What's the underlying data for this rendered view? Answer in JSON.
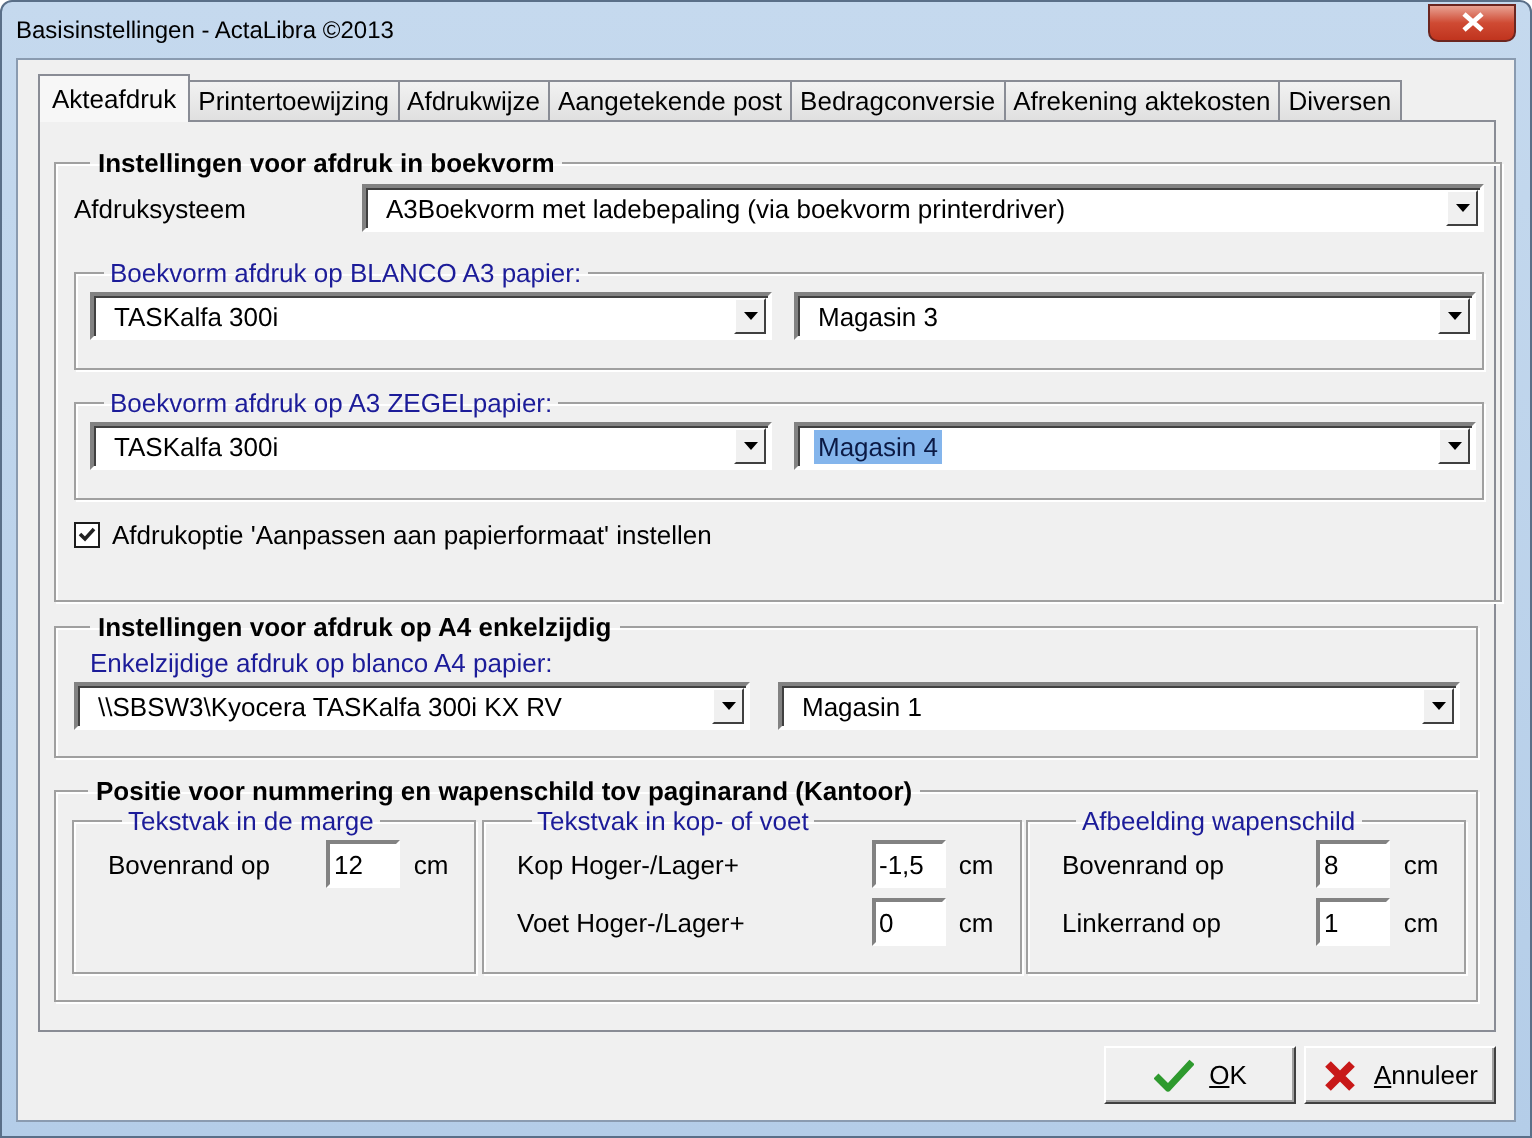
{
  "window": {
    "title": "Basisinstellingen - ActaLibra ©2013"
  },
  "tabs": [
    {
      "label": "Akteafdruk",
      "selected": true
    },
    {
      "label": "Printertoewijzing",
      "selected": false
    },
    {
      "label": "Afdrukwijze",
      "selected": false
    },
    {
      "label": "Aangetekende post",
      "selected": false
    },
    {
      "label": "Bedragconversie",
      "selected": false
    },
    {
      "label": "Afrekening aktekosten",
      "selected": false
    },
    {
      "label": "Diversen",
      "selected": false
    }
  ],
  "book_group": {
    "title": "Instellingen voor afdruk in boekvorm",
    "system": {
      "label": "Afdruksysteem",
      "value": "A3Boekvorm met ladebepaling (via boekvorm printerdriver)"
    },
    "subgroups": [
      {
        "title": "Boekvorm afdruk op BLANCO A3 papier:",
        "printer": {
          "value": "TASKalfa 300i",
          "focused": false
        },
        "tray": {
          "value": "Magasin 3",
          "focused": false
        }
      },
      {
        "title": "Boekvorm afdruk op A3 ZEGELpapier:",
        "printer": {
          "value": "TASKalfa 300i",
          "focused": false
        },
        "tray": {
          "value": "Magasin 4",
          "focused": true
        }
      }
    ],
    "option": {
      "label": "Afdrukoptie 'Aanpassen aan papierformaat' instellen",
      "checked": true
    }
  },
  "a4_group": {
    "title": "Instellingen voor afdruk op A4 enkelzijdig",
    "caption": "Enkelzijdige afdruk op blanco A4 papier:",
    "printer": {
      "value": "\\\\SBSW3\\Kyocera TASKalfa 300i KX RV",
      "focused": false
    },
    "tray": {
      "value": "Magasin 1",
      "focused": false
    }
  },
  "position_group": {
    "title": "Positie voor nummering en wapenschild tov paginarand (Kantoor)",
    "panels": [
      {
        "title": "Tekstvak in de marge",
        "fields": [
          {
            "label": "Bovenrand op",
            "value": "12",
            "unit": "cm"
          }
        ]
      },
      {
        "title": "Tekstvak in kop- of voet",
        "fields": [
          {
            "label": "Kop Hoger-/Lager+",
            "value": "-1,5",
            "unit": "cm"
          },
          {
            "label": "Voet Hoger-/Lager+",
            "value": "0",
            "unit": "cm"
          }
        ]
      },
      {
        "title": "Afbeelding wapenschild",
        "fields": [
          {
            "label": "Bovenrand op",
            "value": "8",
            "unit": "cm"
          },
          {
            "label": "Linkerrand op",
            "value": "1",
            "unit": "cm"
          }
        ]
      }
    ]
  },
  "buttons": [
    {
      "label": "OK",
      "kind": "ok"
    },
    {
      "label": "Annuleer",
      "kind": "cancel"
    }
  ]
}
